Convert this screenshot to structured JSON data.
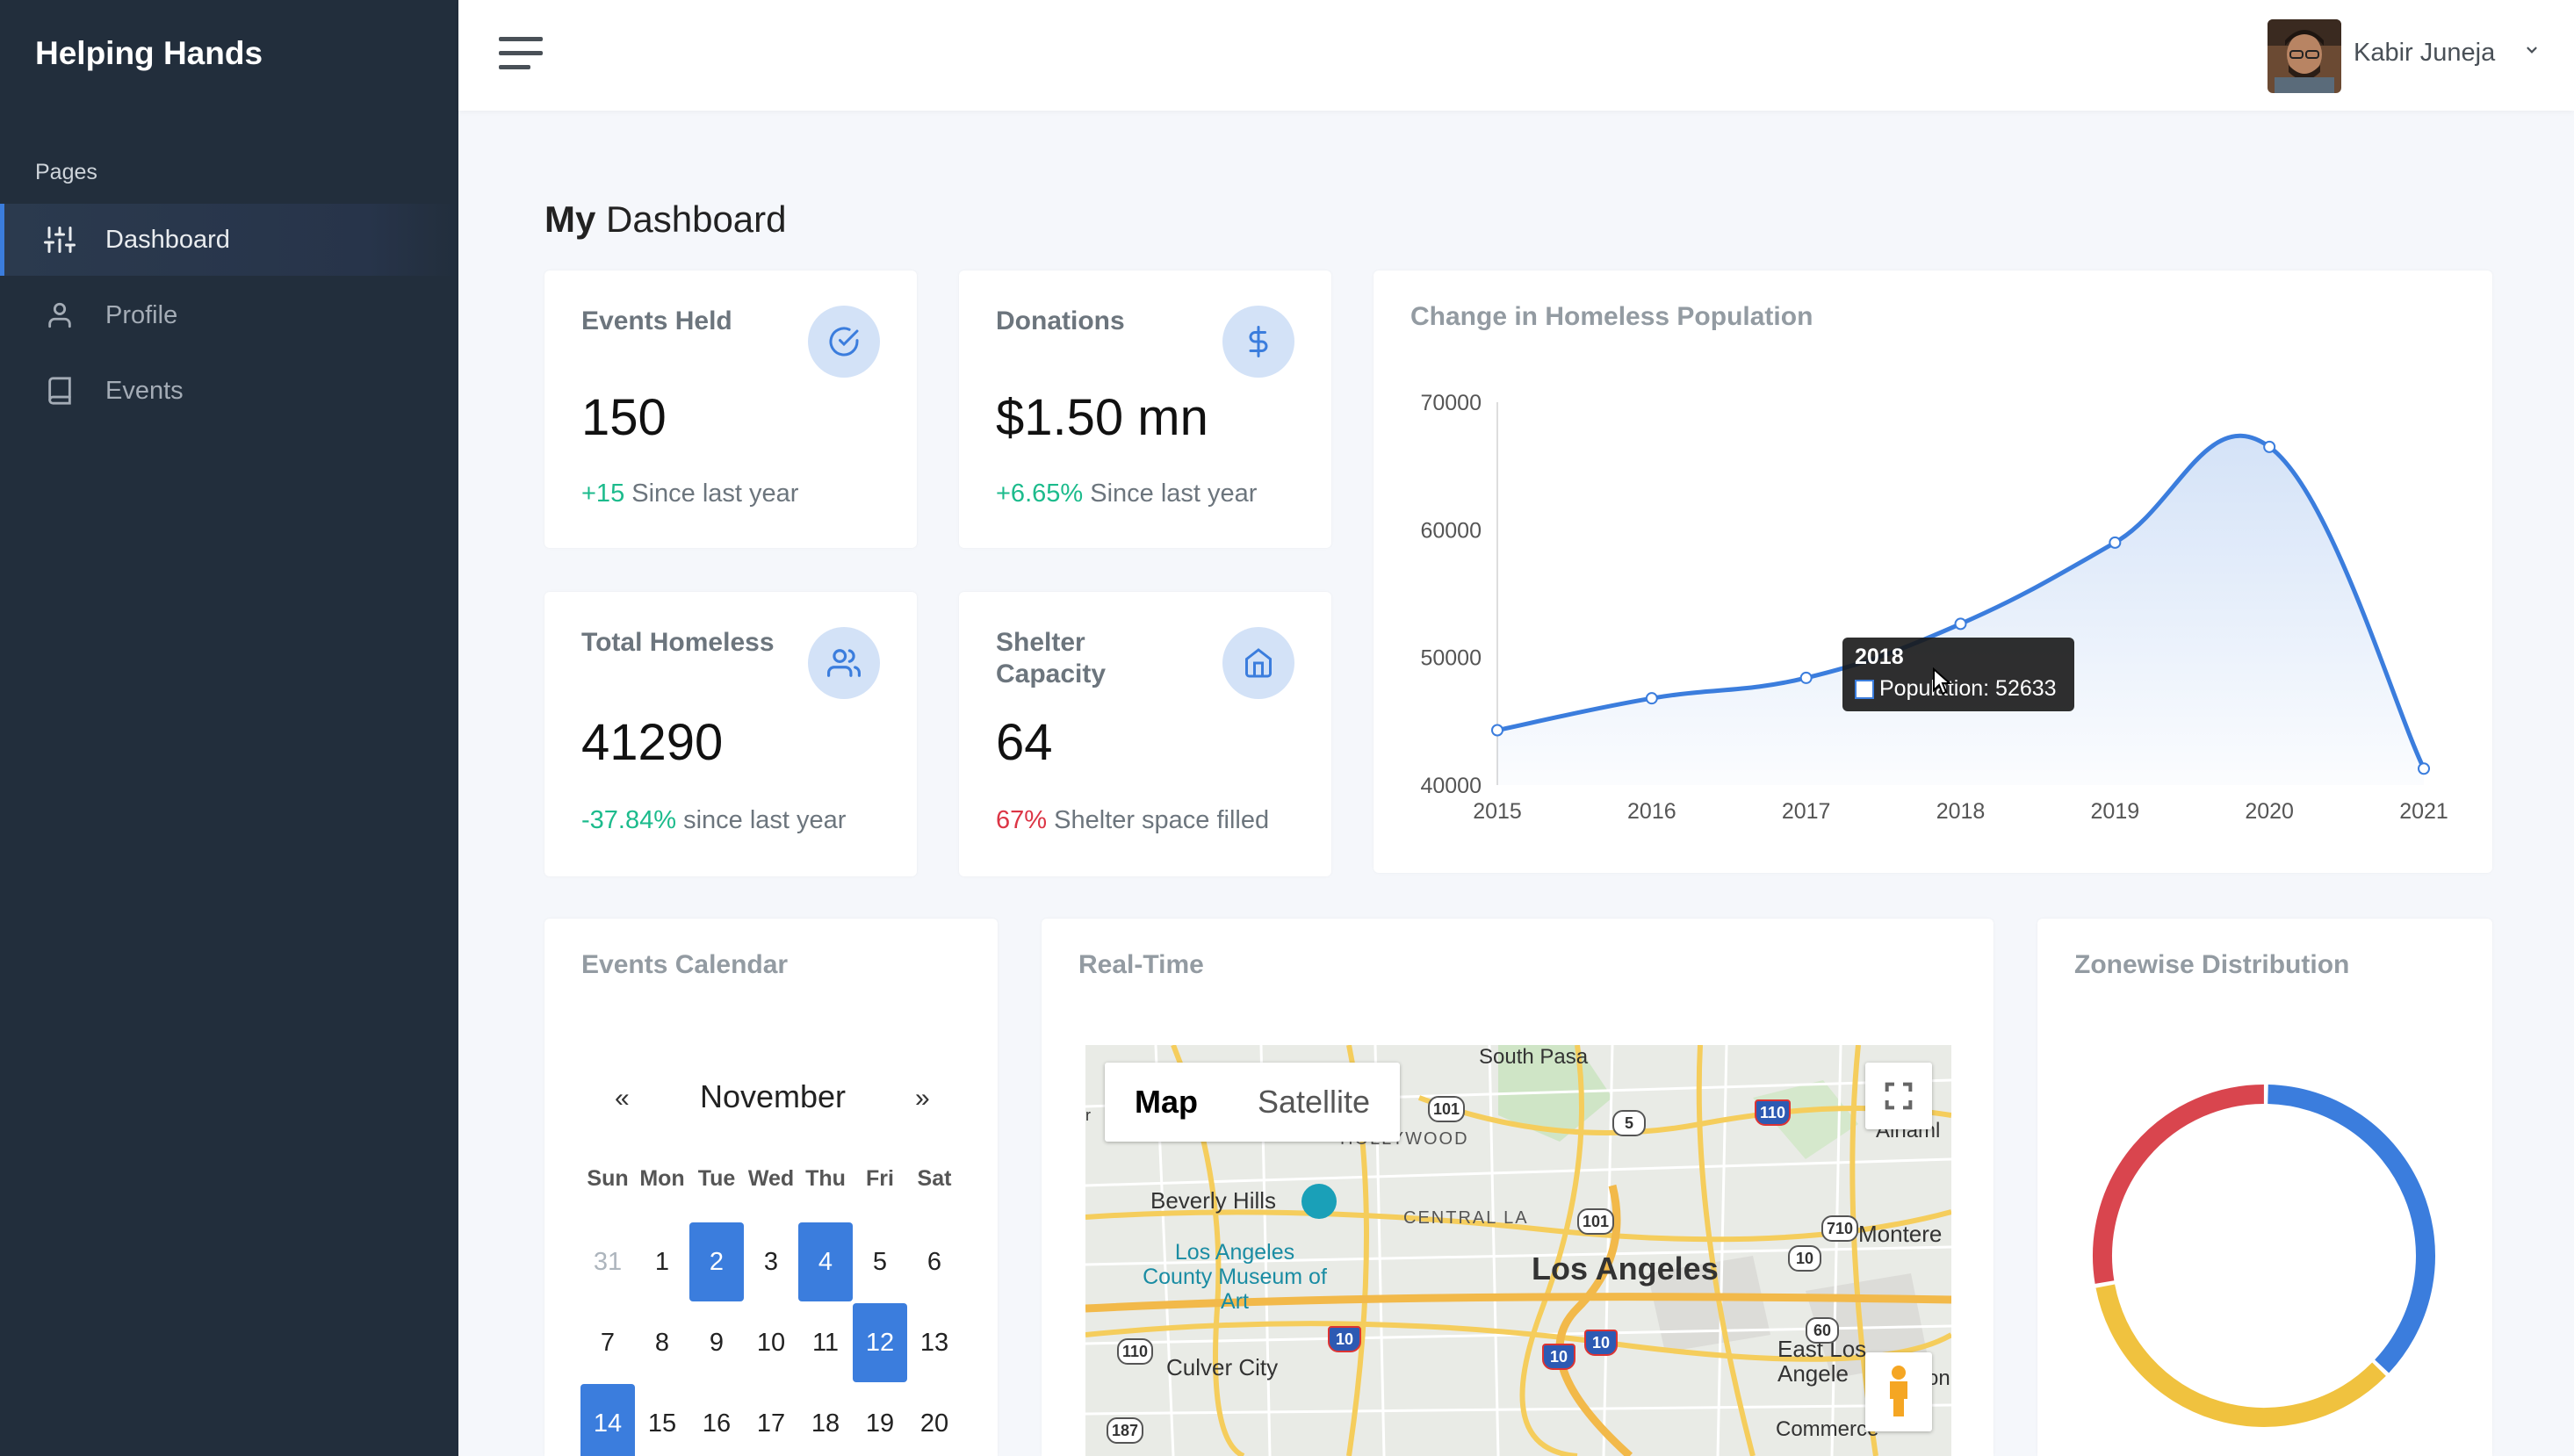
{
  "app": {
    "brand": "Helping Hands"
  },
  "sidebar": {
    "header": "Pages",
    "items": [
      {
        "label": "Dashboard",
        "icon": "sliders-icon",
        "active": true
      },
      {
        "label": "Profile",
        "icon": "user-icon",
        "active": false
      },
      {
        "label": "Events",
        "icon": "book-icon",
        "active": false
      }
    ]
  },
  "topbar": {
    "user_name": "Kabir Juneja"
  },
  "page": {
    "title_bold": "My",
    "title_rest": "Dashboard"
  },
  "stats": [
    {
      "label": "Events Held",
      "icon": "check-circle-icon",
      "value": "150",
      "delta": "+15",
      "delta_type": "positive",
      "foot": "Since last year"
    },
    {
      "label": "Donations",
      "icon": "dollar-icon",
      "value": "$1.50 mn",
      "delta": "+6.65%",
      "delta_type": "positive",
      "foot": "Since last year"
    },
    {
      "label": "Total Homeless",
      "icon": "users-icon",
      "value": "41290",
      "delta": "-37.84%",
      "delta_type": "positive",
      "foot": "since last year"
    },
    {
      "label": "Shelter Capacity",
      "icon": "home-icon",
      "value": "64",
      "delta": "67%",
      "delta_type": "negative",
      "foot": "Shelter space filled"
    }
  ],
  "line_chart": {
    "title": "Change in Homeless Population",
    "tooltip": {
      "title": "2018",
      "text": "Population: 52633"
    }
  },
  "chart_data": {
    "type": "area",
    "title": "Change in Homeless Population",
    "x": [
      "2015",
      "2016",
      "2017",
      "2018",
      "2019",
      "2020",
      "2021"
    ],
    "series": [
      {
        "name": "Population",
        "values": [
          44300,
          46800,
          48400,
          52633,
          59000,
          66500,
          41290
        ],
        "color": "#3b7ddd"
      }
    ],
    "ylim": [
      40000,
      70000
    ],
    "yticks": [
      "70000",
      "60000",
      "50000",
      "40000"
    ],
    "grid": false,
    "legend": "none"
  },
  "calendar": {
    "title": "Events Calendar",
    "month": "November",
    "prev": "«",
    "next": "»",
    "dow": [
      "Sun",
      "Mon",
      "Tue",
      "Wed",
      "Thu",
      "Fri",
      "Sat"
    ],
    "weeks": [
      [
        {
          "d": "31",
          "m": true
        },
        {
          "d": "1"
        },
        {
          "d": "2",
          "s": true
        },
        {
          "d": "3"
        },
        {
          "d": "4",
          "s": true
        },
        {
          "d": "5"
        },
        {
          "d": "6"
        }
      ],
      [
        {
          "d": "7"
        },
        {
          "d": "8"
        },
        {
          "d": "9"
        },
        {
          "d": "10"
        },
        {
          "d": "11"
        },
        {
          "d": "12",
          "s": true
        },
        {
          "d": "13"
        }
      ],
      [
        {
          "d": "14",
          "s": true
        },
        {
          "d": "15"
        },
        {
          "d": "16"
        },
        {
          "d": "17"
        },
        {
          "d": "18"
        },
        {
          "d": "19"
        },
        {
          "d": "20"
        }
      ]
    ]
  },
  "realtime": {
    "title": "Real-Time",
    "tab_map": "Map",
    "tab_satellite": "Satellite",
    "labels": {
      "south_pas": "South Pasa",
      "hollywood": "HOLLYWOOD",
      "beverly_hills": "Beverly Hills",
      "central_la": "CENTRAL LA",
      "lacma": "Los Angeles County Museum of Art",
      "los_angeles": "Los Angeles",
      "monterey": "Montere",
      "culver_city": "Culver City",
      "east_la": "East Los Angele",
      "commerce": "Commerce",
      "alhambra": "Alhaml",
      "r": "r",
      "on": "on"
    },
    "shields": [
      "101",
      "5",
      "110",
      "101",
      "710",
      "10",
      "10",
      "110",
      "10",
      "60",
      "10",
      "187"
    ]
  },
  "zonewise": {
    "title": "Zonewise Distribution"
  },
  "donut_data": {
    "type": "pie",
    "values": [
      37,
      35,
      28
    ],
    "colors": [
      "#3b7ddd",
      "#f0c23f",
      "#d9454e"
    ]
  }
}
